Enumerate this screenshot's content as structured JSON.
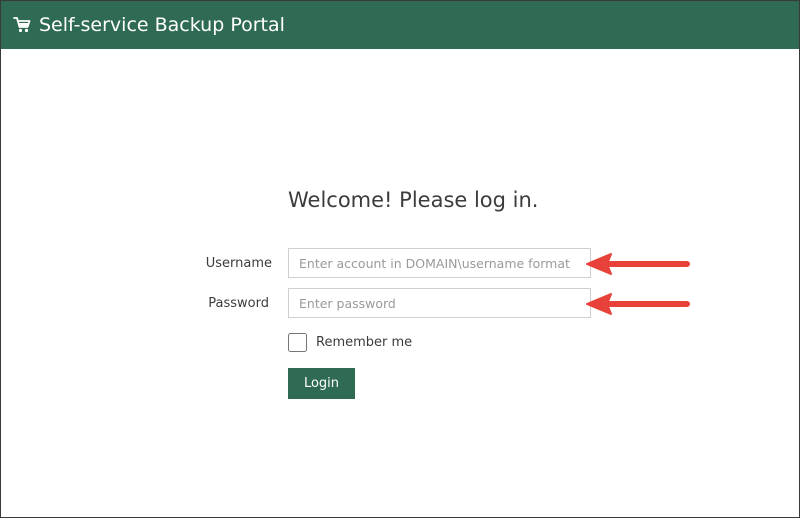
{
  "header": {
    "title": "Self-service Backup Portal",
    "icon": "cart-icon",
    "background": "#2f6b52"
  },
  "login": {
    "welcome": "Welcome! Please log in.",
    "username_label": "Username",
    "username_placeholder": "Enter account in DOMAIN\\username format",
    "username_value": "",
    "password_label": "Password",
    "password_placeholder": "Enter password",
    "password_value": "",
    "remember_label": "Remember me",
    "remember_checked": false,
    "login_label": "Login"
  },
  "annotations": {
    "arrow_color": "#e8413a",
    "arrow_icon": "arrow-left-icon"
  }
}
